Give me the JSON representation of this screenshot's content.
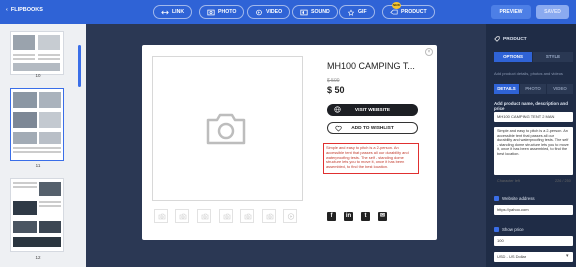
{
  "topbar": {
    "back_label": "FLIPBOOKS",
    "tools": [
      "LINK",
      "PHOTO",
      "VIDEO",
      "SOUND",
      "GIF",
      "PRODUCT"
    ],
    "new_badge": "NEW",
    "preview_label": "PREVIEW",
    "save_label": "SAVED"
  },
  "pages": {
    "thumb_numbers": [
      "10",
      "11",
      "12"
    ]
  },
  "product": {
    "title": "MH100 CAMPING T...",
    "old_price": "$ 500",
    "price": "$ 50",
    "visit_label": "VISIT WEBSITE",
    "wishlist_label": "ADD TO WISHLIST",
    "description": "Simple and easy to pitch is a 2-person. An accessible tent that passes all our durability and waterproofing tests. The self - standing dome structure lets you to move it, once it has been assembled, to find the best location."
  },
  "panel": {
    "title": "PRODUCT",
    "tabs": [
      "OPTIONS",
      "STYLE"
    ],
    "hint": "Add product details, photos and videos",
    "subtabs": [
      "DETAILS",
      "PHOTO",
      "VIDEO"
    ],
    "name_label": "Add product name, description and price",
    "name_value": "MH100 CAMPING TENT 2 MAN",
    "description_value": "Simple and easy to pitch is a 2-person. An accessible tent that passes all our durability and waterproofing tests. The self - standing dome structure lets you to move it, once it has been assembled, to find the best location.",
    "char_left_label": "Character left",
    "char_count": "226 / 250",
    "website_label": "Website address",
    "website_value": "https://yahoo.com",
    "price_label": "Show price",
    "price_value": "100",
    "currency_value": "USD - US Dollar"
  },
  "colors": {
    "accent": "#2f63d6",
    "highlight": "#e03030",
    "sidebar": "#1f2c46"
  }
}
